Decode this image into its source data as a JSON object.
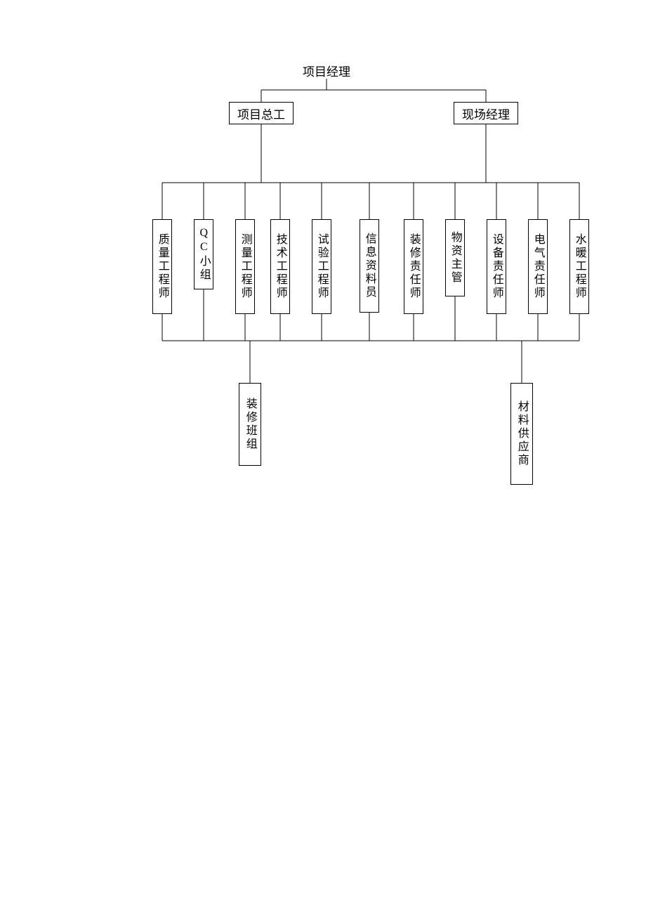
{
  "top": {
    "label": "项目经理"
  },
  "mid": {
    "left": "项目总工",
    "right": "现场经理"
  },
  "roles": [
    "质量工程师",
    "QC小组",
    "测量工程师",
    "技术工程师",
    "试验工程师",
    "信息资料员",
    "装修责任师",
    "物资主管",
    "设备责任师",
    "电气责任师",
    "水暖工程师"
  ],
  "bottom": {
    "left": "装修班组",
    "right": "材料供应商"
  }
}
